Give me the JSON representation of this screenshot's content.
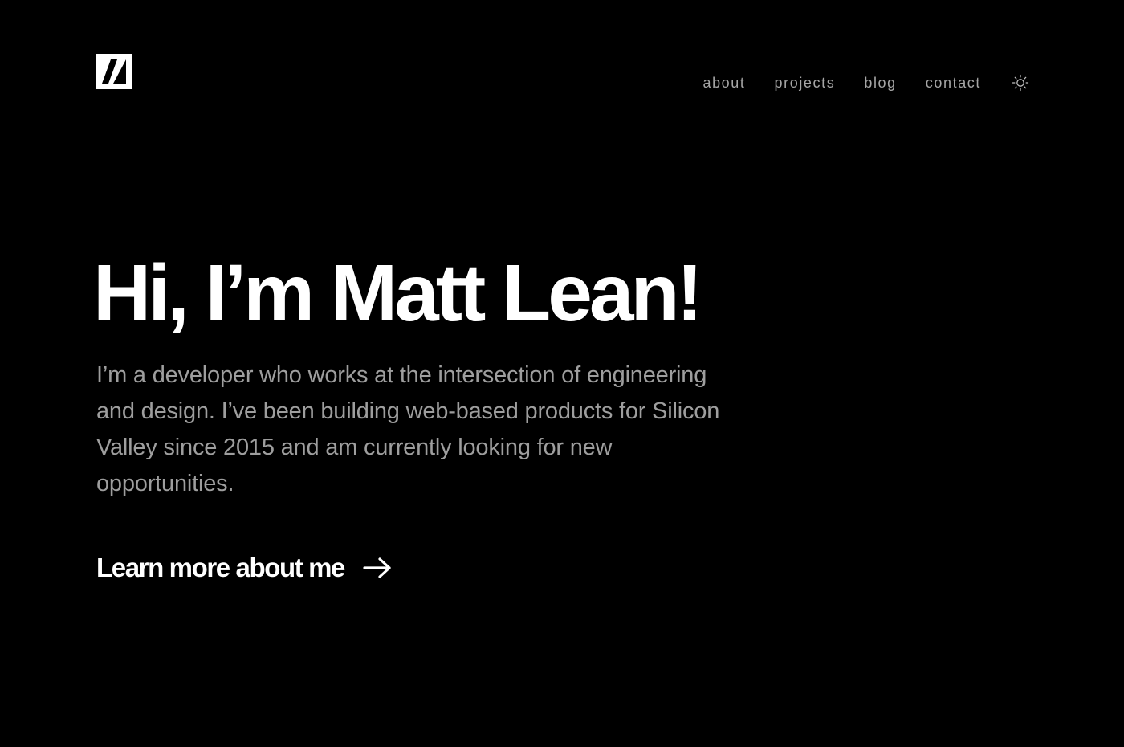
{
  "header": {
    "logo_icon": "m-logo-icon",
    "nav": [
      {
        "label": "about"
      },
      {
        "label": "projects"
      },
      {
        "label": "blog"
      },
      {
        "label": "contact"
      }
    ],
    "theme_toggle_icon": "sun-icon"
  },
  "hero": {
    "title": "Hi, I’m Matt Lean!",
    "description": "I’m a developer who works at the intersection of engineering and design. I’ve been building web-based products for Silicon Valley since 2015 and am currently looking for new opportunities.",
    "cta_label": "Learn more about me",
    "cta_icon": "arrow-right-icon"
  },
  "colors": {
    "background": "#000000",
    "title": "#ffffff",
    "body_text": "#9e9e9e",
    "nav_text": "#a6a6a6"
  }
}
